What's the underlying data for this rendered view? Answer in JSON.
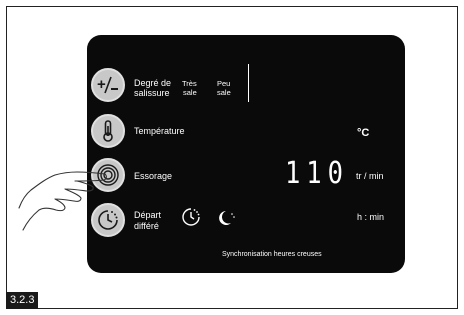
{
  "panel": {
    "soil": {
      "label_line1": "Degré de",
      "label_line2": "salissure",
      "opt1_l1": "Très",
      "opt1_l2": "sale",
      "opt2_l1": "Peu",
      "opt2_l2": "sale"
    },
    "temperature": {
      "label": "Température",
      "unit": "°C"
    },
    "spin": {
      "label": "Essorage",
      "display_value": "110",
      "unit": "tr / min"
    },
    "delay": {
      "label_line1": "Départ",
      "label_line2": "différé",
      "unit": "h : min"
    },
    "footer": "Synchronisation heures creuses",
    "icons": [
      "plus-minus-icon",
      "thermometer-icon",
      "spin-icon",
      "delay-clock-icon",
      "timer-icon",
      "night-moon-icon",
      "pointing-hand-icon"
    ]
  },
  "caption": "3.2.3"
}
